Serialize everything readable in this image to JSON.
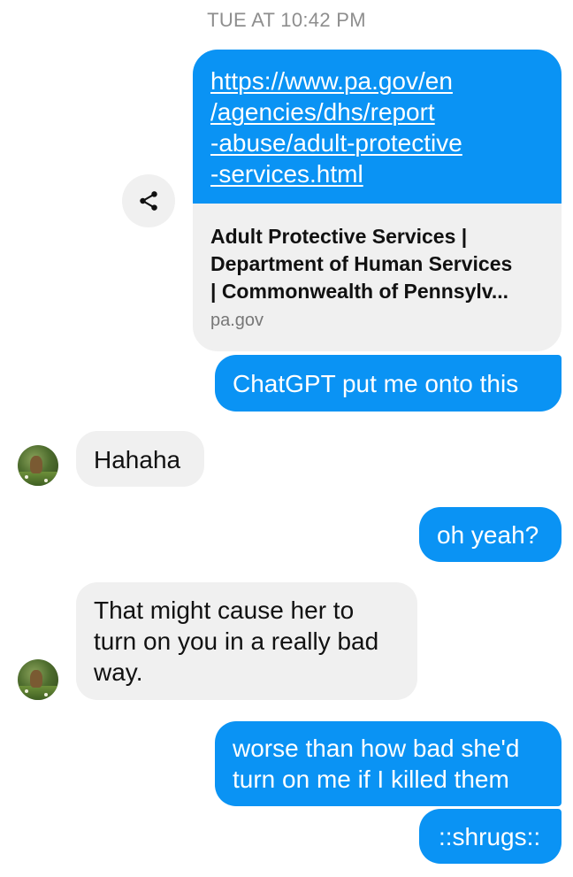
{
  "timestamp": "TUE AT 10:42 PM",
  "link_message": {
    "url_lines": [
      "https://www.pa.gov/en",
      "/agencies/dhs/report",
      "-abuse/adult-protective",
      "-services.html"
    ],
    "preview_title_lines": [
      "Adult Protective Services |",
      "Department of Human Services",
      "| Commonwealth of Pennsylv..."
    ],
    "preview_domain": "pa.gov",
    "share_icon": "share-icon"
  },
  "messages": [
    {
      "direction": "outgoing",
      "lines": [
        "ChatGPT put me onto this"
      ]
    },
    {
      "direction": "incoming",
      "lines": [
        "Hahaha"
      ]
    },
    {
      "direction": "outgoing",
      "lines": [
        "oh yeah?"
      ]
    },
    {
      "direction": "incoming",
      "lines": [
        "That might cause her to",
        "turn on you in a really bad",
        "way."
      ]
    },
    {
      "direction": "outgoing",
      "lines": [
        "worse than how bad she'd",
        "turn on me if I killed them"
      ]
    },
    {
      "direction": "outgoing",
      "lines": [
        "::shrugs::"
      ]
    }
  ],
  "colors": {
    "outgoing_bubble": "#0a93f4",
    "incoming_bubble": "#f0f0f0",
    "timestamp_text": "#8e8e8e"
  }
}
